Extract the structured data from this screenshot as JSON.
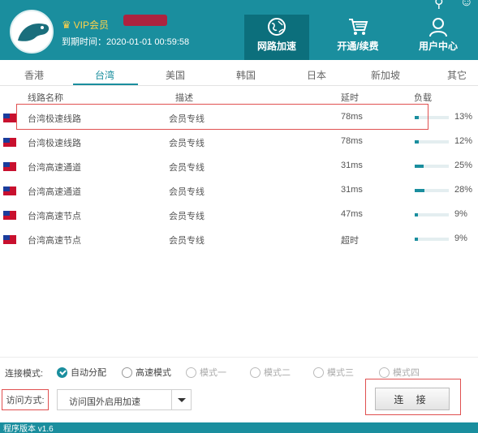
{
  "header": {
    "vip_label": "VIP会员",
    "expire_label": "到期时间：2020-01-01 00:59:58",
    "nav": [
      {
        "label": "网路加速",
        "icon": "globe-icon",
        "active": true
      },
      {
        "label": "开通/续费",
        "icon": "cart-icon",
        "active": false
      },
      {
        "label": "用户中心",
        "icon": "user-icon",
        "active": false
      }
    ]
  },
  "tabs": [
    "香港",
    "台湾",
    "美国",
    "韩国",
    "日本",
    "新加坡",
    "其它"
  ],
  "active_tab": "台湾",
  "table": {
    "columns": [
      "线路名称",
      "描述",
      "延时",
      "负载"
    ],
    "rows": [
      {
        "name": "台湾极速线路",
        "desc": "会员专线",
        "latency": "78ms",
        "load": "13%",
        "load_value": 13
      },
      {
        "name": "台湾极速线路",
        "desc": "会员专线",
        "latency": "78ms",
        "load": "12%",
        "load_value": 12
      },
      {
        "name": "台湾高速通道",
        "desc": "会员专线",
        "latency": "31ms",
        "load": "25%",
        "load_value": 25
      },
      {
        "name": "台湾高速通道",
        "desc": "会员专线",
        "latency": "31ms",
        "load": "28%",
        "load_value": 28
      },
      {
        "name": "台湾高速节点",
        "desc": "会员专线",
        "latency": "47ms",
        "load": "9%",
        "load_value": 9
      },
      {
        "name": "台湾高速节点",
        "desc": "会员专线",
        "latency": "超时",
        "load": "9%",
        "load_value": 9
      }
    ]
  },
  "connection_mode": {
    "label": "连接模式:",
    "options": [
      {
        "label": "自动分配",
        "checked": true,
        "disabled": false
      },
      {
        "label": "高速模式",
        "checked": false,
        "disabled": false
      },
      {
        "label": "模式一",
        "checked": false,
        "disabled": true
      },
      {
        "label": "模式二",
        "checked": false,
        "disabled": true
      },
      {
        "label": "模式三",
        "checked": false,
        "disabled": true
      },
      {
        "label": "模式四",
        "checked": false,
        "disabled": true
      }
    ]
  },
  "access": {
    "label": "访问方式:",
    "selected": "访问国外启用加速"
  },
  "connect_label": "连 接",
  "status": "程序版本 v1.6",
  "colors": {
    "accent": "#1a8e9e",
    "highlight": "#e05050",
    "vip": "#ffd24a"
  }
}
